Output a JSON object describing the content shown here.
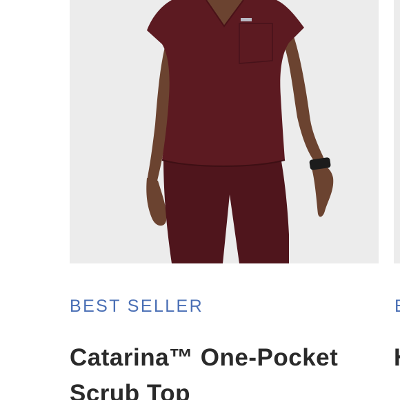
{
  "colors": {
    "badge": "#4a6fb5",
    "title": "#2a2a2a",
    "image_bg": "#ececec",
    "scrub": "#5c1a21"
  },
  "product": {
    "image_alt": "Model wearing burgundy scrub top and pants",
    "badge": "BEST SELLER",
    "title": "Catarina™ One-Pocket Scrub Top"
  },
  "next_product": {
    "badge": "B",
    "title": "H"
  }
}
